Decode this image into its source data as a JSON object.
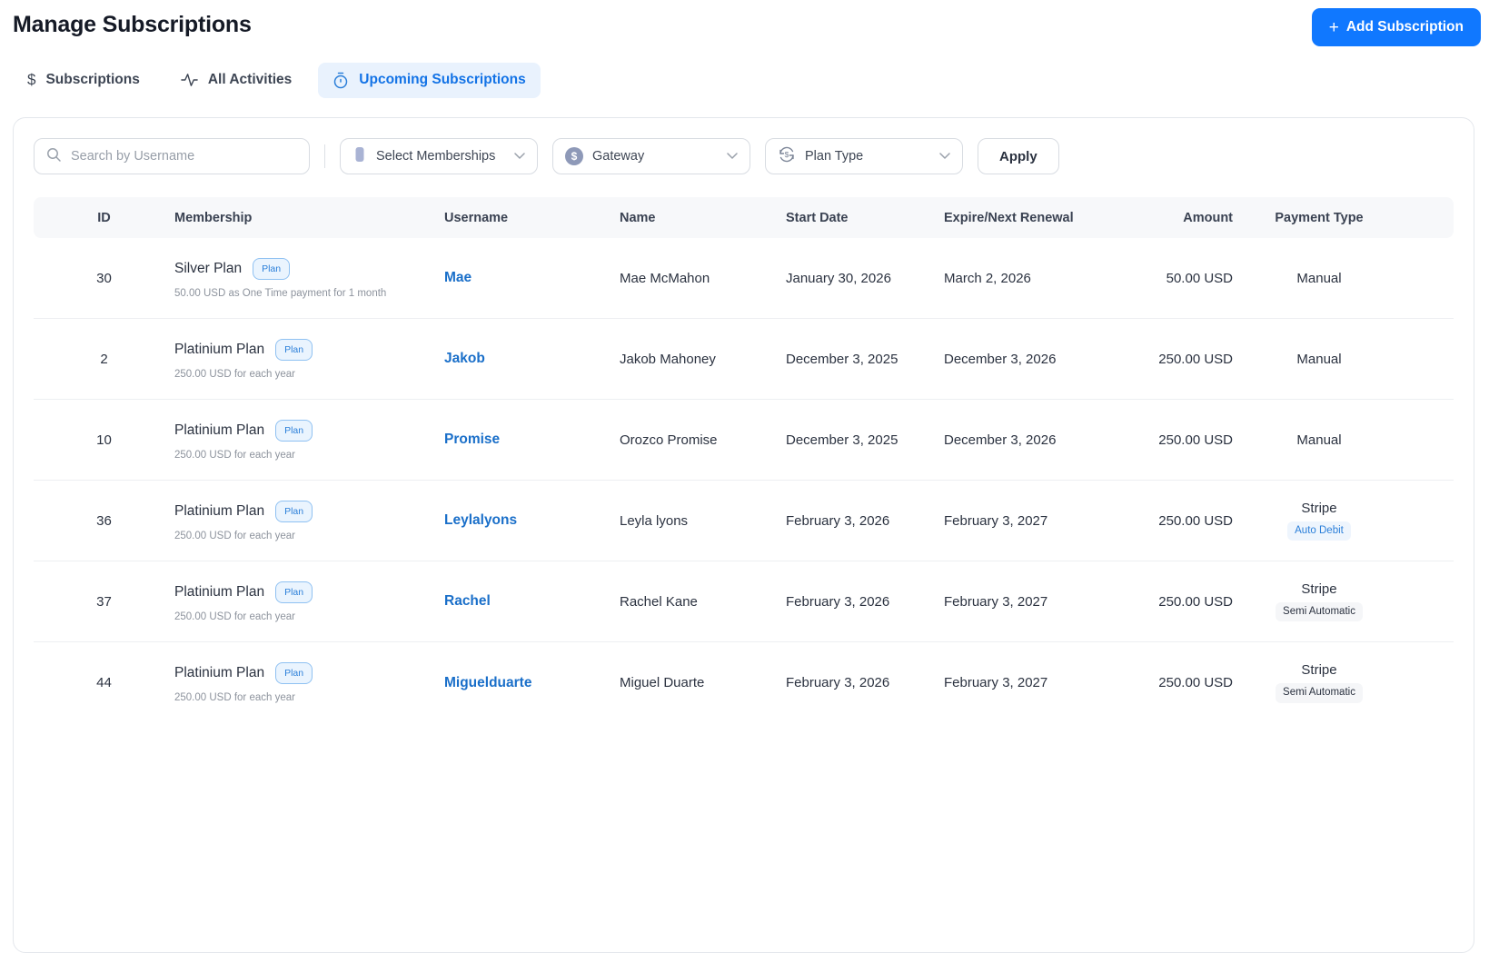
{
  "colors": {
    "accent_blue": "#1373e6",
    "button_blue": "#1078ff",
    "link_blue": "#1a6fc9",
    "active_tab_bg": "#e9f2fd",
    "badge_text": "#2b7fd9",
    "badge_bg": "#eaf4fe",
    "badge_border": "#8fc1f2"
  },
  "page": {
    "title": "Manage Subscriptions"
  },
  "header": {
    "add_plus": "+",
    "add_label": "Add Subscription"
  },
  "tabs": [
    {
      "label": "Subscriptions",
      "icon": "dollar-icon",
      "active": false
    },
    {
      "label": "All Activities",
      "icon": "activity-icon",
      "active": false
    },
    {
      "label": "Upcoming Subscriptions",
      "icon": "stopwatch-icon",
      "active": true
    }
  ],
  "filters": {
    "search_placeholder": "Search by Username",
    "memberships_label": "Select Memberships",
    "gateway_label": "Gateway",
    "plan_type_label": "Plan Type",
    "apply_label": "Apply"
  },
  "table": {
    "headers": [
      "ID",
      "Membership",
      "Username",
      "Name",
      "Start Date",
      "Expire/Next Renewal",
      "Amount",
      "Payment Type"
    ],
    "rows": [
      {
        "id": "30",
        "membership": "Silver Plan",
        "badge": "Plan",
        "membership_desc": "50.00 USD as One Time payment for 1 month",
        "username": "Mae",
        "name": "Mae McMahon",
        "start_date": "January 30, 2026",
        "expire_date": "March 2, 2026",
        "amount": "50.00 USD",
        "payment": "Manual",
        "payment_sub": null,
        "payment_sub_style": null
      },
      {
        "id": "2",
        "membership": "Platinium Plan",
        "badge": "Plan",
        "membership_desc": "250.00 USD for each year",
        "username": "Jakob",
        "name": "Jakob Mahoney",
        "start_date": "December 3, 2025",
        "expire_date": "December 3, 2026",
        "amount": "250.00 USD",
        "payment": "Manual",
        "payment_sub": null,
        "payment_sub_style": null
      },
      {
        "id": "10",
        "membership": "Platinium Plan",
        "badge": "Plan",
        "membership_desc": "250.00 USD for each year",
        "username": "Promise",
        "name": "Orozco Promise",
        "start_date": "December 3, 2025",
        "expire_date": "December 3, 2026",
        "amount": "250.00 USD",
        "payment": "Manual",
        "payment_sub": null,
        "payment_sub_style": null
      },
      {
        "id": "36",
        "membership": "Platinium Plan",
        "badge": "Plan",
        "membership_desc": "250.00 USD for each year",
        "username": "Leylalyons",
        "name": "Leyla lyons",
        "start_date": "February 3, 2026",
        "expire_date": "February 3, 2027",
        "amount": "250.00 USD",
        "payment": "Stripe",
        "payment_sub": "Auto Debit",
        "payment_sub_style": "blue"
      },
      {
        "id": "37",
        "membership": "Platinium Plan",
        "badge": "Plan",
        "membership_desc": "250.00 USD for each year",
        "username": "Rachel",
        "name": "Rachel Kane",
        "start_date": "February 3, 2026",
        "expire_date": "February 3, 2027",
        "amount": "250.00 USD",
        "payment": "Stripe",
        "payment_sub": "Semi Automatic",
        "payment_sub_style": "gray"
      },
      {
        "id": "44",
        "membership": "Platinium Plan",
        "badge": "Plan",
        "membership_desc": "250.00 USD for each year",
        "username": "Miguelduarte",
        "name": "Miguel Duarte",
        "start_date": "February 3, 2026",
        "expire_date": "February 3, 2027",
        "amount": "250.00 USD",
        "payment": "Stripe",
        "payment_sub": "Semi Automatic",
        "payment_sub_style": "gray"
      }
    ]
  }
}
